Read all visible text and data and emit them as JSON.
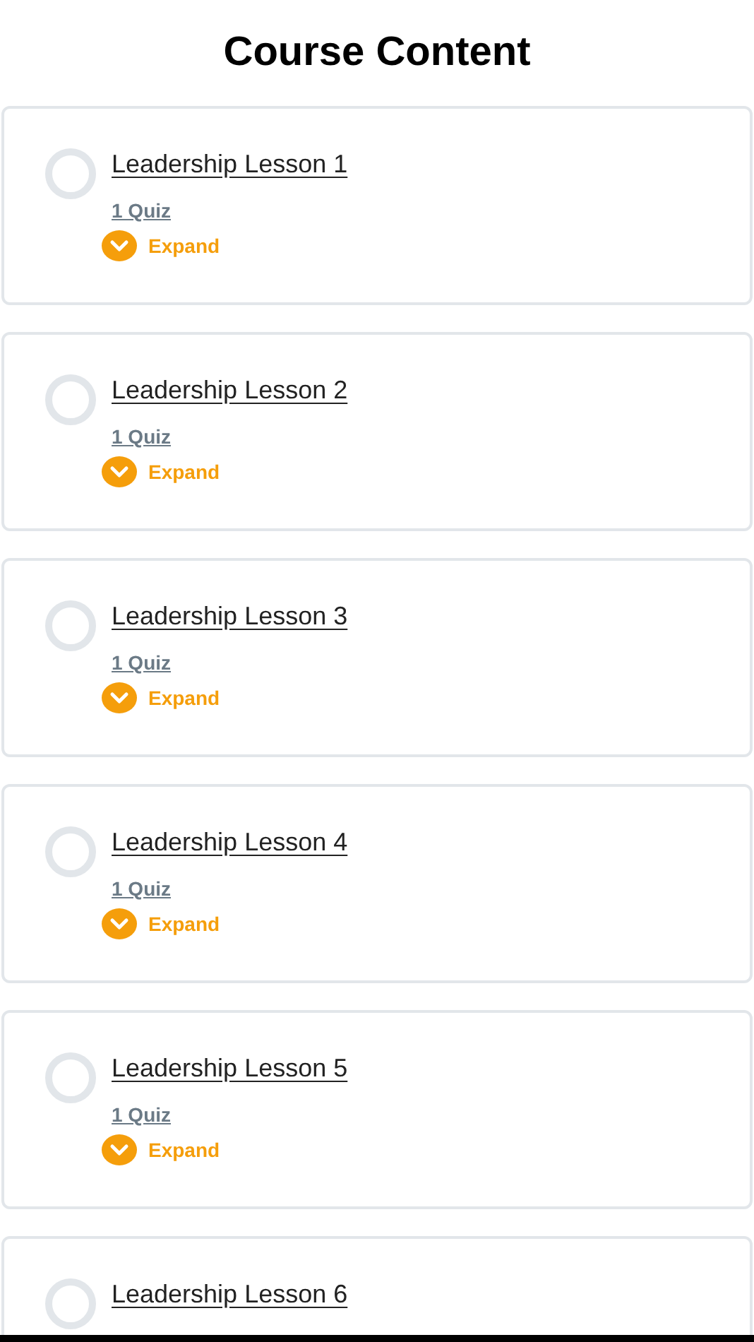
{
  "title": "Course Content",
  "lessons": [
    {
      "title": "Leadership Lesson 1",
      "completed": false,
      "quiz": "1 Quiz",
      "expand": {
        "label": "Expand",
        "expanded": false
      }
    },
    {
      "title": "Leadership Lesson 2",
      "completed": false,
      "quiz": "1 Quiz",
      "expand": {
        "label": "Expand",
        "expanded": false
      }
    },
    {
      "title": "Leadership Lesson 3",
      "completed": false,
      "quiz": "1 Quiz",
      "expand": {
        "label": "Expand",
        "expanded": false
      }
    },
    {
      "title": "Leadership Lesson 4",
      "completed": false,
      "quiz": "1 Quiz",
      "expand": {
        "label": "Expand",
        "expanded": false
      }
    },
    {
      "title": "Leadership Lesson 5",
      "completed": false,
      "quiz": "1 Quiz",
      "expand": {
        "label": "Expand",
        "expanded": false
      }
    },
    {
      "title": "Leadership Lesson 6",
      "completed": false
    }
  ]
}
